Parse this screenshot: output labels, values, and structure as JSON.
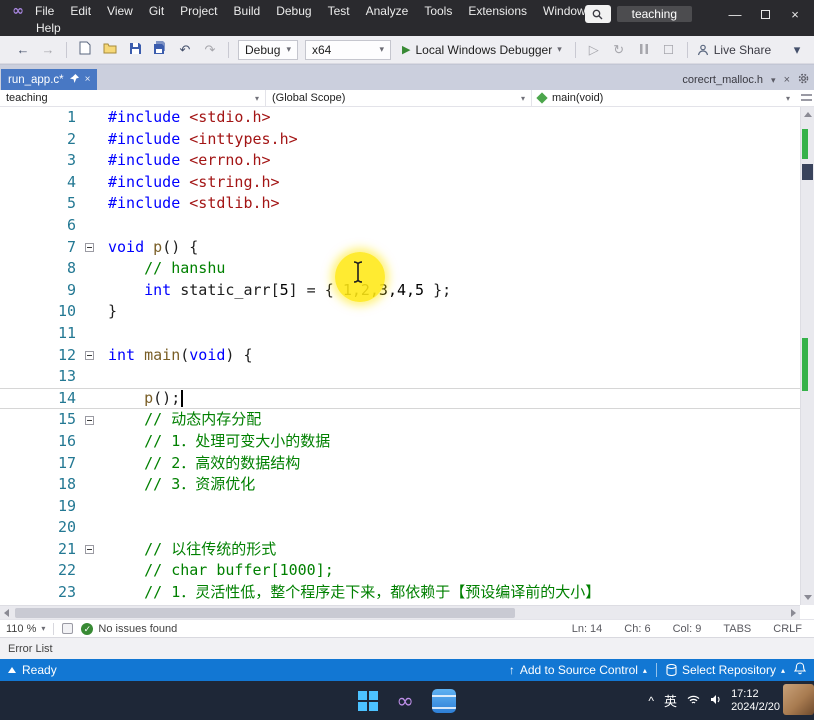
{
  "colors": {
    "titlebar_bg": "#2A2A2E",
    "toolbar_bg": "#EEEEF2",
    "tabwell_bg": "#CBCFDD",
    "active_tab_bg": "#4878C4",
    "statusbar_bg": "#1277D3",
    "taskbar_bg": "#1E2737",
    "keyword_blue": "#0000FF",
    "header_red": "#A31515",
    "function_brown": "#795E26",
    "comment_green": "#008000",
    "line_number": "#237893",
    "highlight_yellow": "#FFE814",
    "run_green": "#388A34"
  },
  "icons": {
    "vs_logo": "∞",
    "minimize": "—",
    "close": "×",
    "back": "←",
    "forward": "→",
    "undo": "↶",
    "redo": "↷",
    "reload": "↻",
    "caret_down": "▾",
    "caret_up": "▴",
    "play": "▶",
    "play_outline": "▷",
    "up_arrow": "↑",
    "chevron_up": "^",
    "check": "✓",
    "infinity": "∞"
  },
  "titlebar": {
    "menus": [
      "File",
      "Edit",
      "View",
      "Git",
      "Project",
      "Build",
      "Debug",
      "Test",
      "Analyze",
      "Tools",
      "Extensions",
      "Window",
      "Help"
    ],
    "solution": "teaching"
  },
  "toolbar": {
    "config": "Debug",
    "platform": "x64",
    "run": "Local Windows Debugger",
    "live_share": "Live Share"
  },
  "tabbar": {
    "active": "run_app.c*",
    "secondary": "corecrt_malloc.h"
  },
  "navbar": {
    "project": "teaching",
    "scope": "(Global Scope)",
    "member": "main(void)"
  },
  "editor": {
    "zoom": "110 %",
    "health": "No issues found",
    "ln": "Ln: 14",
    "ch": "Ch: 6",
    "col": "Col: 9",
    "tabs": "TABS",
    "eol": "CRLF",
    "lines": [
      {
        "n": "1",
        "tokens": [
          {
            "t": "#include ",
            "c": "kw"
          },
          {
            "t": "<stdio.h>",
            "c": "str"
          }
        ]
      },
      {
        "n": "2",
        "tokens": [
          {
            "t": "#include ",
            "c": "kw"
          },
          {
            "t": "<inttypes.h>",
            "c": "str"
          }
        ]
      },
      {
        "n": "3",
        "tokens": [
          {
            "t": "#include ",
            "c": "kw"
          },
          {
            "t": "<errno.h>",
            "c": "str"
          }
        ]
      },
      {
        "n": "4",
        "tokens": [
          {
            "t": "#include ",
            "c": "kw"
          },
          {
            "t": "<string.h>",
            "c": "str"
          }
        ]
      },
      {
        "n": "5",
        "tokens": [
          {
            "t": "#include ",
            "c": "kw"
          },
          {
            "t": "<stdlib.h>",
            "c": "str"
          }
        ]
      },
      {
        "n": "6",
        "tokens": []
      },
      {
        "n": "7",
        "fold": true,
        "tokens": [
          {
            "t": "void",
            "c": "kw"
          },
          {
            "t": " "
          },
          {
            "t": "p",
            "c": "fn"
          },
          {
            "t": "() {"
          }
        ]
      },
      {
        "n": "8",
        "tokens": [
          {
            "t": "    "
          },
          {
            "t": "// hanshu",
            "c": "cmt"
          }
        ]
      },
      {
        "n": "9",
        "tokens": [
          {
            "t": "    "
          },
          {
            "t": "int",
            "c": "kw"
          },
          {
            "t": " "
          },
          {
            "t": "static_arr"
          },
          {
            "t": "["
          },
          {
            "t": "5",
            "c": "num"
          },
          {
            "t": "] = { "
          },
          {
            "t": "1,2,3,4,5",
            "c": "num"
          },
          {
            "t": " };"
          }
        ]
      },
      {
        "n": "10",
        "tokens": [
          {
            "t": "}"
          }
        ]
      },
      {
        "n": "11",
        "tokens": []
      },
      {
        "n": "12",
        "fold": true,
        "tokens": [
          {
            "t": "int",
            "c": "kw"
          },
          {
            "t": " "
          },
          {
            "t": "main",
            "c": "fn"
          },
          {
            "t": "("
          },
          {
            "t": "void",
            "c": "kw"
          },
          {
            "t": ") {"
          }
        ]
      },
      {
        "n": "13",
        "tokens": []
      },
      {
        "n": "14",
        "current": true,
        "tokens": [
          {
            "t": "    "
          },
          {
            "t": "p",
            "c": "fn"
          },
          {
            "t": "();"
          }
        ]
      },
      {
        "n": "15",
        "fold": true,
        "tokens": [
          {
            "t": "    "
          },
          {
            "t": "// 动态内存分配",
            "c": "cmt"
          }
        ]
      },
      {
        "n": "16",
        "tokens": [
          {
            "t": "    "
          },
          {
            "t": "// 1．处理可变大小的数据",
            "c": "cmt"
          }
        ]
      },
      {
        "n": "17",
        "tokens": [
          {
            "t": "    "
          },
          {
            "t": "// 2．高效的数据结构",
            "c": "cmt"
          }
        ]
      },
      {
        "n": "18",
        "tokens": [
          {
            "t": "    "
          },
          {
            "t": "// 3．资源优化",
            "c": "cmt"
          }
        ]
      },
      {
        "n": "19",
        "tokens": []
      },
      {
        "n": "20",
        "tokens": []
      },
      {
        "n": "21",
        "fold": true,
        "tokens": [
          {
            "t": "    "
          },
          {
            "t": "// 以往传统的形式",
            "c": "cmt"
          }
        ]
      },
      {
        "n": "22",
        "tokens": [
          {
            "t": "    "
          },
          {
            "t": "// char buffer[1000];",
            "c": "cmt"
          }
        ]
      },
      {
        "n": "23",
        "tokens": [
          {
            "t": "    "
          },
          {
            "t": "// 1．灵活性低，整个程序走下来，都依赖于【预设编译前的大小】",
            "c": "cmt"
          }
        ]
      }
    ]
  },
  "panels": {
    "error_list": "Error List"
  },
  "statusbar": {
    "ready": "Ready",
    "add_source_control": "Add to Source Control",
    "select_repository": "Select Repository"
  },
  "taskbar": {
    "ime": "英",
    "time": "17:12",
    "date": "2024/2/20"
  }
}
